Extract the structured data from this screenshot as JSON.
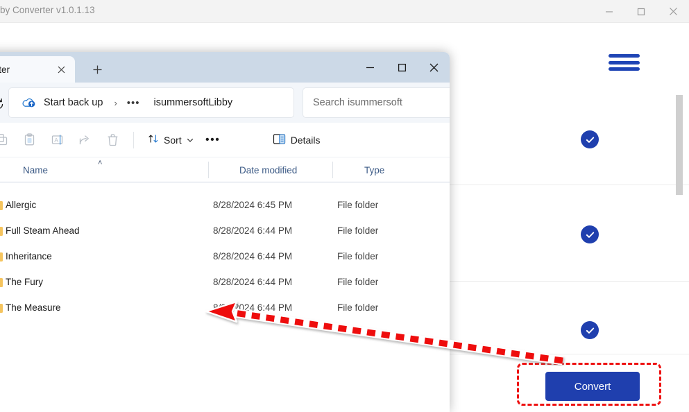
{
  "background_window": {
    "title": "by Converter v1.0.1.13",
    "controls": [
      {
        "name": "minimize",
        "glyph": "minimize-icon"
      },
      {
        "name": "maximize",
        "glyph": "maximize-icon"
      },
      {
        "name": "close",
        "glyph": "close-icon"
      }
    ],
    "menu_icon": "hamburger-menu-icon",
    "rows": [
      {
        "status_icon": "check-circle-icon"
      },
      {
        "status_icon": "check-circle-icon"
      },
      {
        "status_icon": "check-circle-icon"
      }
    ],
    "convert_button": {
      "label": "Convert",
      "color": "#1f3fae",
      "highlight_color": "#ee1111"
    },
    "accent_color": "#1f3fae"
  },
  "explorer": {
    "tab": {
      "label": "nverter",
      "close_icon": "close-icon"
    },
    "new_tab_icon": "plus-icon",
    "controls": [
      {
        "name": "minimize",
        "glyph": "minimize-icon"
      },
      {
        "name": "maximize",
        "glyph": "maximize-icon"
      },
      {
        "name": "close",
        "glyph": "close-icon"
      }
    ],
    "address_bar": {
      "refresh_icon": "refresh-icon",
      "cloud_icon": "onedrive-backup-icon",
      "backup_label": "Start back up",
      "separator": "›",
      "overflow": "•••",
      "path": "isummersoftLibby",
      "search_placeholder": "Search isummersoft"
    },
    "toolbar": {
      "icons": [
        {
          "name": "copy-icon",
          "enabled": false
        },
        {
          "name": "paste-icon",
          "enabled": false
        },
        {
          "name": "rename-icon",
          "enabled": false
        },
        {
          "name": "share-icon",
          "enabled": false
        },
        {
          "name": "delete-icon",
          "enabled": false
        }
      ],
      "sort_label": "Sort",
      "sort_icon": "sort-arrows-icon",
      "sort_chevron": "chevron-down-icon",
      "more_label": "•••",
      "details_label": "Details",
      "details_icon": "details-pane-icon"
    },
    "columns": [
      {
        "label": "Name",
        "sorted": "asc",
        "sort_caret": "˄"
      },
      {
        "label": "Date modified",
        "sorted": ""
      },
      {
        "label": "Type",
        "sorted": ""
      }
    ],
    "files": [
      {
        "icon": "folder-icon",
        "name": "Allergic",
        "date_modified": "8/28/2024 6:45 PM",
        "type": "File folder"
      },
      {
        "icon": "folder-icon",
        "name": "Full Steam Ahead",
        "date_modified": "8/28/2024 6:44 PM",
        "type": "File folder"
      },
      {
        "icon": "folder-icon",
        "name": "Inheritance",
        "date_modified": "8/28/2024 6:44 PM",
        "type": "File folder"
      },
      {
        "icon": "folder-icon",
        "name": "The Fury",
        "date_modified": "8/28/2024 6:44 PM",
        "type": "File folder"
      },
      {
        "icon": "folder-icon",
        "name": "The Measure",
        "date_modified": "8/28/2024 6:44 PM",
        "type": "File folder"
      }
    ]
  },
  "annotation": {
    "arrow": "red-dashed-arrow",
    "arrow_color": "#ee1111",
    "direction": "points-left-to-file-list"
  }
}
